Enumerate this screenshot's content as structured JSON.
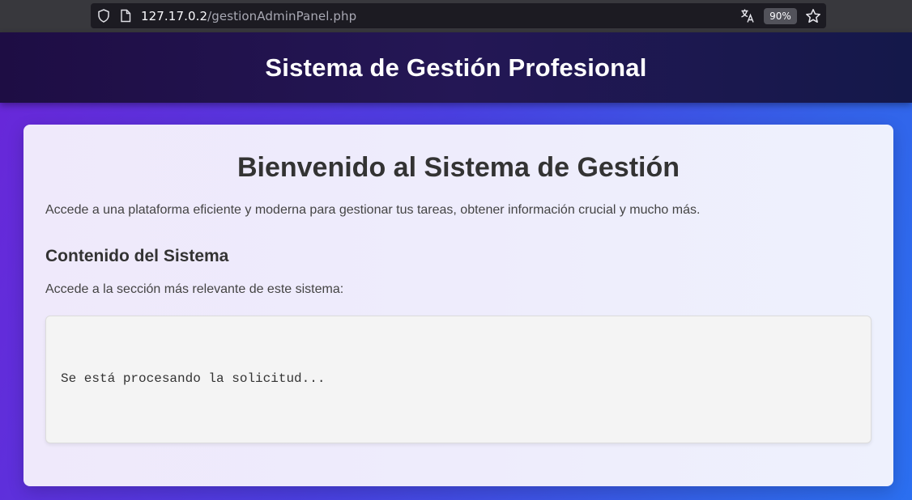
{
  "browser": {
    "url_host": "127.17.0.2",
    "url_path": "/gestionAdminPanel.php",
    "zoom": "90%",
    "icons": [
      "shield-icon",
      "page-icon",
      "translate-icon",
      "star-icon"
    ]
  },
  "header": {
    "title": "Sistema de Gestión Profesional"
  },
  "main": {
    "heading": "Bienvenido al Sistema de Gestión",
    "intro": "Accede a una plataforma eficiente y moderna para gestionar tus tareas, obtener información crucial y mucho más.",
    "section_title": "Contenido del Sistema",
    "section_desc": "Accede a la sección más relevante de este sistema:",
    "status_text": "Se está procesando la solicitud..."
  },
  "colors": {
    "header_bg": "#1e0d44",
    "page_gradient_start": "#6a26d8",
    "page_gradient_end": "#2b6ff0",
    "card_bg": "#eeecfc"
  }
}
